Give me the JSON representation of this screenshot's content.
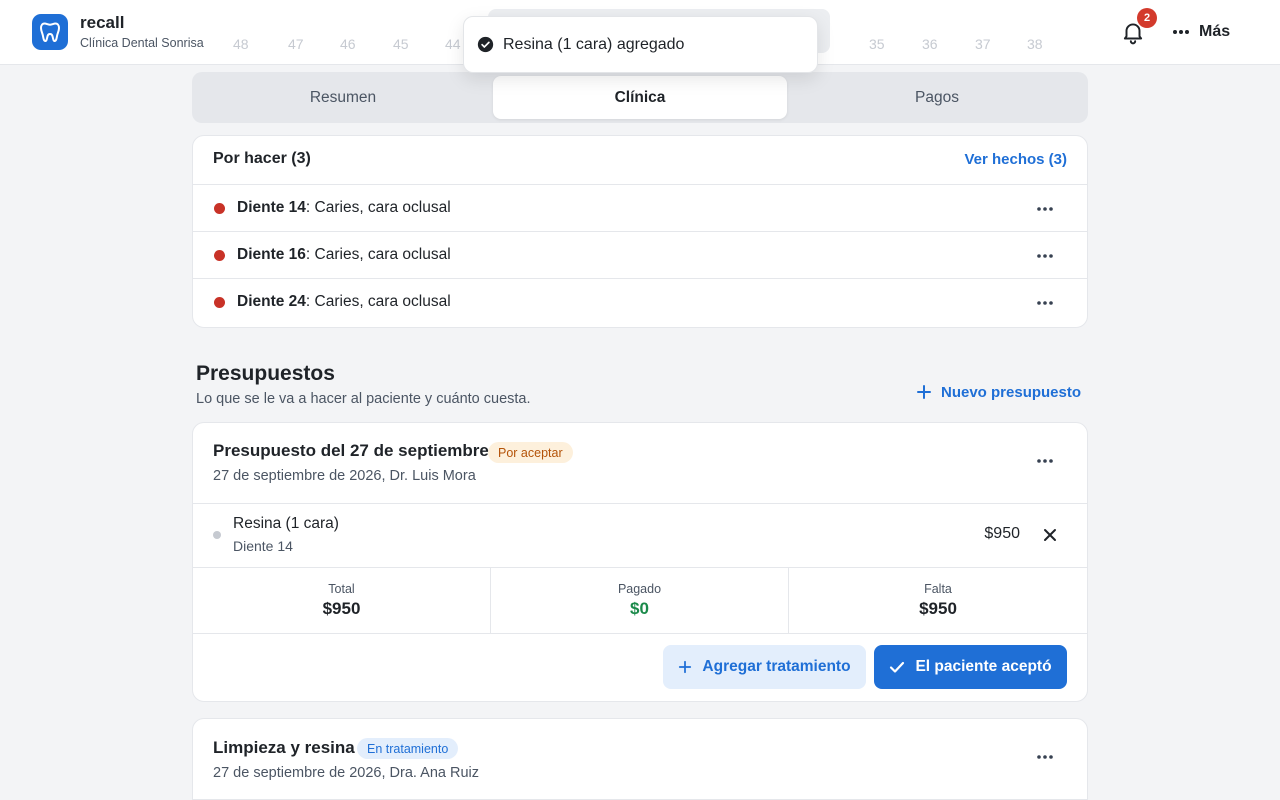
{
  "app": {
    "name": "recall",
    "clinic": "Clínica Dental Sonrisa",
    "accent": "#1f6fd6"
  },
  "header": {
    "notifications_count": "2",
    "more_label": "Más",
    "tooth_numbers_left": [
      "48",
      "47",
      "46",
      "45",
      "44"
    ],
    "tooth_numbers_right": [
      "35",
      "36",
      "37",
      "38"
    ]
  },
  "toast": {
    "message": "Resina (1 cara) agregado",
    "icon": "check-circle-icon"
  },
  "tabs": [
    {
      "label": "Resumen",
      "active": false
    },
    {
      "label": "Clínica",
      "active": true
    },
    {
      "label": "Pagos",
      "active": false
    }
  ],
  "todo": {
    "title": "Por hacer (3)",
    "link": "Ver hechos (3)",
    "items": [
      {
        "tooth": "Diente 14",
        "desc": ": Caries, cara oclusal"
      },
      {
        "tooth": "Diente 16",
        "desc": ": Caries, cara oclusal"
      },
      {
        "tooth": "Diente 24",
        "desc": ": Caries, cara oclusal"
      }
    ]
  },
  "budgets_section": {
    "title": "Presupuestos",
    "subtitle": "Lo que se le va a hacer al paciente y cuánto cuesta.",
    "new_button": "Nuevo presupuesto"
  },
  "budget1": {
    "title": "Presupuesto del 27 de septiembre",
    "status": "Por aceptar",
    "meta": "27 de septiembre de 2026, Dr. Luis Mora",
    "items": [
      {
        "name": "Resina (1 cara)",
        "tooth": "Diente 14",
        "price": "$950"
      }
    ],
    "summary": [
      {
        "label": "Total",
        "value": "$950"
      },
      {
        "label": "Pagado",
        "value": "$0"
      },
      {
        "label": "Falta",
        "value": "$950"
      }
    ],
    "add_button": "Agregar tratamiento",
    "accept_button": "El paciente aceptó"
  },
  "budget2": {
    "title": "Limpieza y resina",
    "status": "En tratamiento",
    "meta": "27 de septiembre de 2026, Dra. Ana Ruiz"
  }
}
